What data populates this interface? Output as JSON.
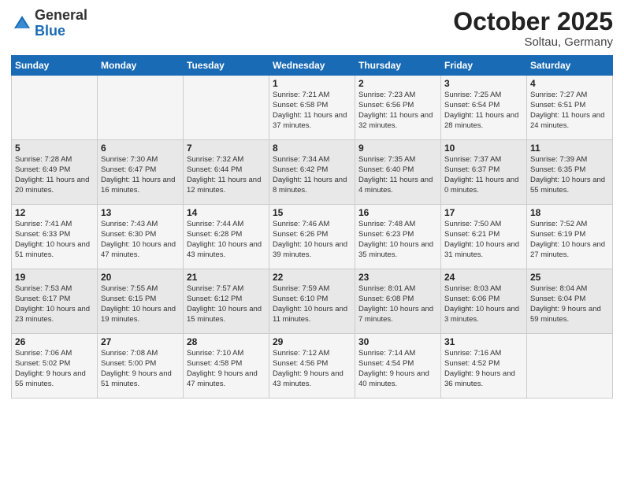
{
  "logo": {
    "general": "General",
    "blue": "Blue"
  },
  "title": "October 2025",
  "location": "Soltau, Germany",
  "days_header": [
    "Sunday",
    "Monday",
    "Tuesday",
    "Wednesday",
    "Thursday",
    "Friday",
    "Saturday"
  ],
  "weeks": [
    [
      {
        "day": "",
        "info": ""
      },
      {
        "day": "",
        "info": ""
      },
      {
        "day": "",
        "info": ""
      },
      {
        "day": "1",
        "info": "Sunrise: 7:21 AM\nSunset: 6:58 PM\nDaylight: 11 hours\nand 37 minutes."
      },
      {
        "day": "2",
        "info": "Sunrise: 7:23 AM\nSunset: 6:56 PM\nDaylight: 11 hours\nand 32 minutes."
      },
      {
        "day": "3",
        "info": "Sunrise: 7:25 AM\nSunset: 6:54 PM\nDaylight: 11 hours\nand 28 minutes."
      },
      {
        "day": "4",
        "info": "Sunrise: 7:27 AM\nSunset: 6:51 PM\nDaylight: 11 hours\nand 24 minutes."
      }
    ],
    [
      {
        "day": "5",
        "info": "Sunrise: 7:28 AM\nSunset: 6:49 PM\nDaylight: 11 hours\nand 20 minutes."
      },
      {
        "day": "6",
        "info": "Sunrise: 7:30 AM\nSunset: 6:47 PM\nDaylight: 11 hours\nand 16 minutes."
      },
      {
        "day": "7",
        "info": "Sunrise: 7:32 AM\nSunset: 6:44 PM\nDaylight: 11 hours\nand 12 minutes."
      },
      {
        "day": "8",
        "info": "Sunrise: 7:34 AM\nSunset: 6:42 PM\nDaylight: 11 hours\nand 8 minutes."
      },
      {
        "day": "9",
        "info": "Sunrise: 7:35 AM\nSunset: 6:40 PM\nDaylight: 11 hours\nand 4 minutes."
      },
      {
        "day": "10",
        "info": "Sunrise: 7:37 AM\nSunset: 6:37 PM\nDaylight: 11 hours\nand 0 minutes."
      },
      {
        "day": "11",
        "info": "Sunrise: 7:39 AM\nSunset: 6:35 PM\nDaylight: 10 hours\nand 55 minutes."
      }
    ],
    [
      {
        "day": "12",
        "info": "Sunrise: 7:41 AM\nSunset: 6:33 PM\nDaylight: 10 hours\nand 51 minutes."
      },
      {
        "day": "13",
        "info": "Sunrise: 7:43 AM\nSunset: 6:30 PM\nDaylight: 10 hours\nand 47 minutes."
      },
      {
        "day": "14",
        "info": "Sunrise: 7:44 AM\nSunset: 6:28 PM\nDaylight: 10 hours\nand 43 minutes."
      },
      {
        "day": "15",
        "info": "Sunrise: 7:46 AM\nSunset: 6:26 PM\nDaylight: 10 hours\nand 39 minutes."
      },
      {
        "day": "16",
        "info": "Sunrise: 7:48 AM\nSunset: 6:23 PM\nDaylight: 10 hours\nand 35 minutes."
      },
      {
        "day": "17",
        "info": "Sunrise: 7:50 AM\nSunset: 6:21 PM\nDaylight: 10 hours\nand 31 minutes."
      },
      {
        "day": "18",
        "info": "Sunrise: 7:52 AM\nSunset: 6:19 PM\nDaylight: 10 hours\nand 27 minutes."
      }
    ],
    [
      {
        "day": "19",
        "info": "Sunrise: 7:53 AM\nSunset: 6:17 PM\nDaylight: 10 hours\nand 23 minutes."
      },
      {
        "day": "20",
        "info": "Sunrise: 7:55 AM\nSunset: 6:15 PM\nDaylight: 10 hours\nand 19 minutes."
      },
      {
        "day": "21",
        "info": "Sunrise: 7:57 AM\nSunset: 6:12 PM\nDaylight: 10 hours\nand 15 minutes."
      },
      {
        "day": "22",
        "info": "Sunrise: 7:59 AM\nSunset: 6:10 PM\nDaylight: 10 hours\nand 11 minutes."
      },
      {
        "day": "23",
        "info": "Sunrise: 8:01 AM\nSunset: 6:08 PM\nDaylight: 10 hours\nand 7 minutes."
      },
      {
        "day": "24",
        "info": "Sunrise: 8:03 AM\nSunset: 6:06 PM\nDaylight: 10 hours\nand 3 minutes."
      },
      {
        "day": "25",
        "info": "Sunrise: 8:04 AM\nSunset: 6:04 PM\nDaylight: 9 hours\nand 59 minutes."
      }
    ],
    [
      {
        "day": "26",
        "info": "Sunrise: 7:06 AM\nSunset: 5:02 PM\nDaylight: 9 hours\nand 55 minutes."
      },
      {
        "day": "27",
        "info": "Sunrise: 7:08 AM\nSunset: 5:00 PM\nDaylight: 9 hours\nand 51 minutes."
      },
      {
        "day": "28",
        "info": "Sunrise: 7:10 AM\nSunset: 4:58 PM\nDaylight: 9 hours\nand 47 minutes."
      },
      {
        "day": "29",
        "info": "Sunrise: 7:12 AM\nSunset: 4:56 PM\nDaylight: 9 hours\nand 43 minutes."
      },
      {
        "day": "30",
        "info": "Sunrise: 7:14 AM\nSunset: 4:54 PM\nDaylight: 9 hours\nand 40 minutes."
      },
      {
        "day": "31",
        "info": "Sunrise: 7:16 AM\nSunset: 4:52 PM\nDaylight: 9 hours\nand 36 minutes."
      },
      {
        "day": "",
        "info": ""
      }
    ]
  ]
}
